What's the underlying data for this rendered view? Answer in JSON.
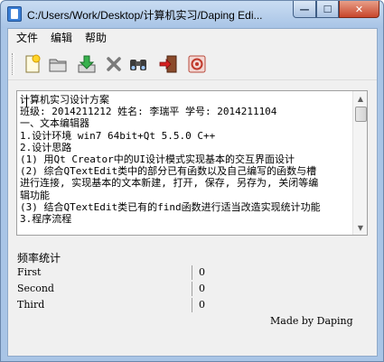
{
  "window": {
    "title": "C:/Users/Work/Desktop/计算机实习/Daping Edi...",
    "controls": {
      "minimize": "—",
      "maximize": "☐",
      "close": "✕"
    }
  },
  "menu": [
    "文件",
    "编辑",
    "帮助"
  ],
  "toolbar": [
    {
      "name": "new-file-icon"
    },
    {
      "name": "open-folder-icon"
    },
    {
      "name": "save-download-icon"
    },
    {
      "name": "delete-x-icon"
    },
    {
      "name": "find-binoculars-icon"
    },
    {
      "name": "exit-door-icon"
    },
    {
      "name": "stats-target-icon"
    }
  ],
  "editor": {
    "lines": [
      "计算机实习设计方案",
      "班级: 2014211212     姓名: 李瑞平    学号: 2014211104",
      "一、文本编辑器",
      "1.设计环境   win7 64bit+Qt 5.5.0  C++",
      "2.设计思路",
      " (1) 用Qt Creator中的UI设计模式实现基本的交互界面设计",
      " (2) 综合QTextEdit类中的部分已有函数以及自己编写的函数与槽",
      "进行连接, 实现基本的文本新建, 打开, 保存, 另存为, 关闭等编",
      "辑功能",
      " (3) 结合QTextEdit类已有的find函数进行适当改造实现统计功能",
      "3.程序流程"
    ]
  },
  "stats": {
    "title": "频率统计",
    "rows": [
      {
        "label": "First",
        "value": "0"
      },
      {
        "label": "Second",
        "value": "0"
      },
      {
        "label": "Third",
        "value": "0"
      }
    ]
  },
  "credit": "Made by Daping",
  "colors": {
    "titlebar": "#a8c4e6",
    "close_button": "#c8462b",
    "client_bg": "#f0f0f0"
  }
}
